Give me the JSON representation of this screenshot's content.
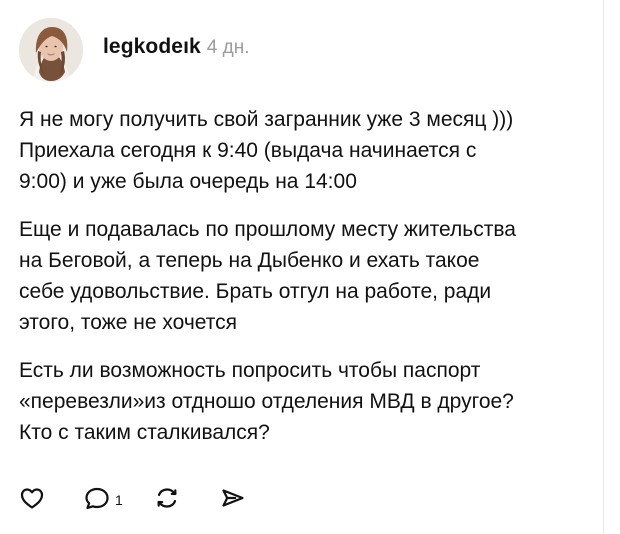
{
  "post": {
    "username": "legkode",
    "username_suffix": "ık",
    "time_ago": "4 дн.",
    "paragraphs": [
      "Я не могу получить свой загранник уже 3 месяц )))\nПриехала сегодня к 9:40 (выдача начинается с\n9:00) и уже была очередь на 14:00",
      "Еще и подавалась по прошлому месту жительства\nна Беговой, а теперь на Дыбенко и ехать такое\nсебе удовольствие. Брать отгул на работе, ради\nэтого, тоже не хочется",
      "Есть ли возможность попросить чтобы паспорт\n«перевезли»из отдношо отделения МВД в другое?\nКто с таким сталкивался?"
    ]
  },
  "actions": {
    "reply_count": "1",
    "icons": {
      "like": "heart-icon",
      "reply": "comment-icon",
      "repost": "repost-icon",
      "share": "share-icon"
    }
  },
  "colors": {
    "text": "#111111",
    "muted": "#9b9b9b",
    "divider": "#e8e8e8"
  }
}
